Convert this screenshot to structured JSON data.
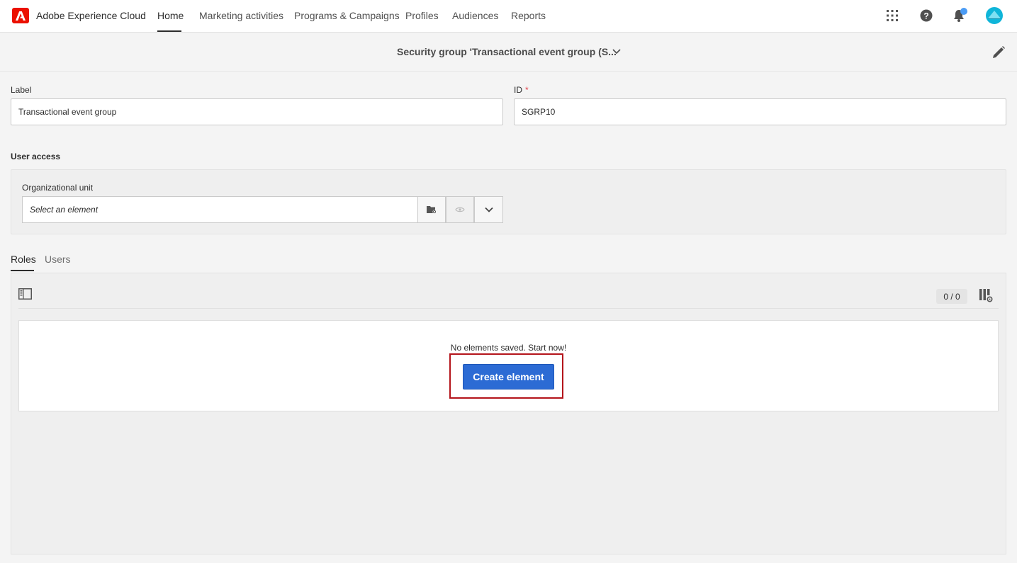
{
  "header": {
    "brand": "Adobe Experience Cloud",
    "tabs": [
      {
        "label": "Home"
      },
      {
        "label": "Marketing activities"
      },
      {
        "label": "Programs & Campaigns"
      },
      {
        "label": "Profiles"
      },
      {
        "label": "Audiences"
      },
      {
        "label": "Reports"
      }
    ],
    "icons": [
      "apps-grid-icon",
      "help-icon",
      "notifications-bell-icon",
      "user-avatar"
    ]
  },
  "titlebar": {
    "title": "Security group 'Transactional event group (S..."
  },
  "form": {
    "label_caption": "Label",
    "label_value": "Transactional event group",
    "id_caption": "ID",
    "id_required": "*",
    "id_value": "SGRP10"
  },
  "user_access": {
    "title": "User access",
    "org_unit_caption": "Organizational unit",
    "org_unit_placeholder": "Select an element"
  },
  "tabs": [
    {
      "label": "Roles"
    },
    {
      "label": "Users"
    }
  ],
  "list": {
    "counter": "0 / 0",
    "empty_message": "No elements saved. Start now!",
    "create_label": "Create element"
  },
  "colors": {
    "brand_red": "#eb1000",
    "primary_button": "#2c6bd4",
    "highlight_outline": "#b4141b",
    "notification_dot": "#4b9cf5"
  }
}
